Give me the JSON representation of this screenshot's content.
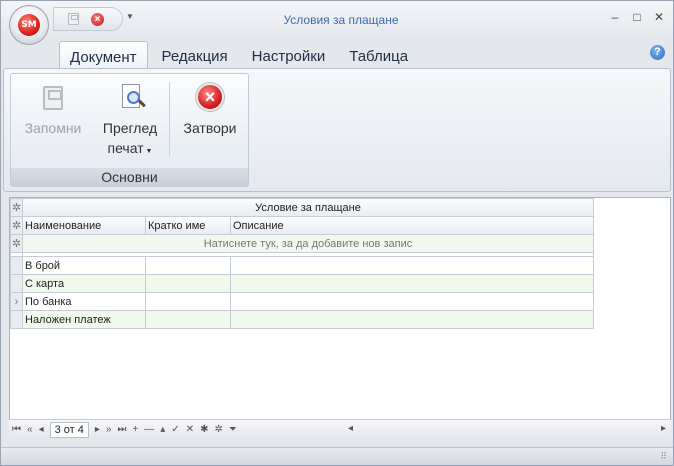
{
  "window": {
    "title": "Условия за плащане"
  },
  "app_orb": {
    "label": "SM"
  },
  "ribbon": {
    "tabs": [
      "Документ",
      "Редакция",
      "Настройки",
      "Таблица"
    ],
    "group_label": "Основни",
    "buttons": {
      "save": "Запомни",
      "preview_line1": "Преглед",
      "preview_line2": "печат",
      "close": "Затвори"
    }
  },
  "grid": {
    "band_header": "Условие за плащане",
    "columns": [
      "Наименование",
      "Кратко име",
      "Описание"
    ],
    "new_row_text": "Натиснете тук, за да добавите нов запис",
    "rows": [
      {
        "name": "В брой",
        "short": "",
        "desc": ""
      },
      {
        "name": "С карта",
        "short": "",
        "desc": ""
      },
      {
        "name": "По банка",
        "short": "",
        "desc": ""
      },
      {
        "name": "Наложен платеж",
        "short": "",
        "desc": ""
      }
    ]
  },
  "navigator": {
    "record_text": "3 от 4"
  }
}
